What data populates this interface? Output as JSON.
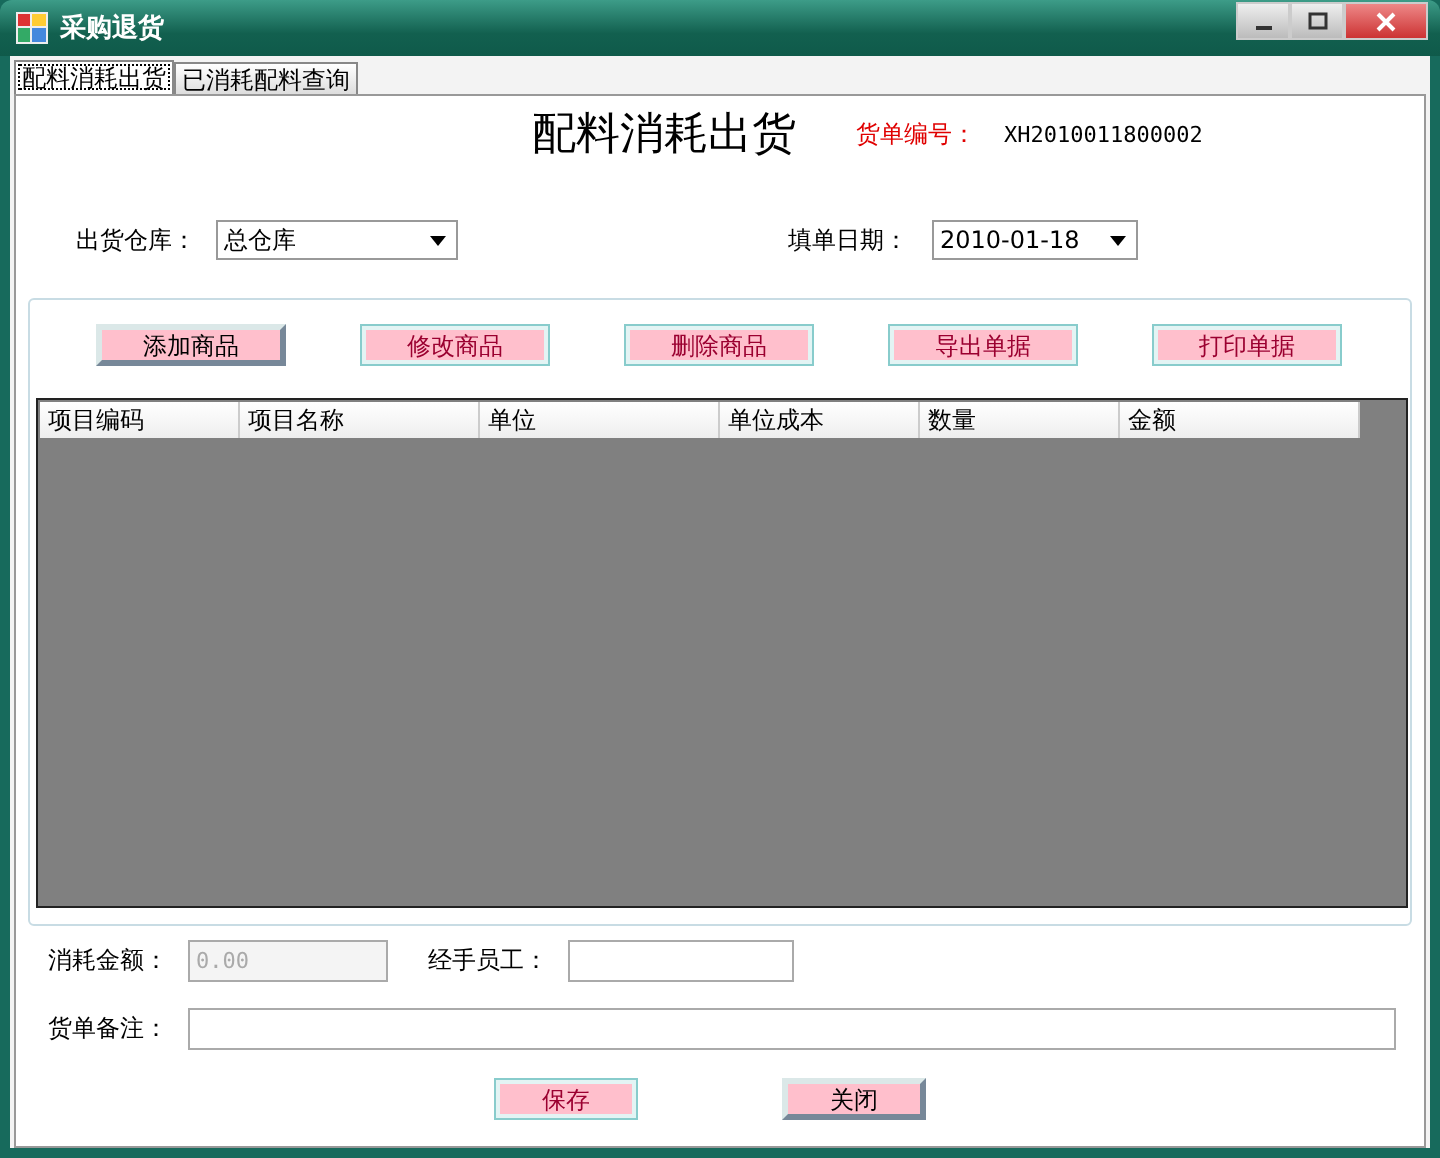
{
  "window": {
    "title": "采购退货"
  },
  "tabs": [
    {
      "label": "配料消耗出货",
      "selected": true
    },
    {
      "label": "已消耗配料查询",
      "selected": false
    }
  ],
  "heading": "配料消耗出货",
  "order_no": {
    "label": "货单编号：",
    "value": "XH2010011800002"
  },
  "warehouse": {
    "label": "出货仓库：",
    "value": "总仓库"
  },
  "date": {
    "label": "填单日期：",
    "value": "2010-01-18"
  },
  "toolbar": [
    {
      "label": "添加商品",
      "kind": "raised"
    },
    {
      "label": "修改商品",
      "kind": "flat"
    },
    {
      "label": "删除商品",
      "kind": "flat"
    },
    {
      "label": "导出单据",
      "kind": "flat"
    },
    {
      "label": "打印单据",
      "kind": "flat"
    }
  ],
  "table": {
    "columns": [
      "项目编码",
      "项目名称",
      "单位",
      "单位成本",
      "数量",
      "金额"
    ]
  },
  "amount": {
    "label": "消耗金额：",
    "value": "0.00",
    "disabled": true
  },
  "employee": {
    "label": "经手员工："
  },
  "remark": {
    "label": "货单备注："
  },
  "buttons": [
    {
      "label": "保存",
      "kind": "flat"
    },
    {
      "label": "关闭",
      "kind": "raised"
    }
  ]
}
